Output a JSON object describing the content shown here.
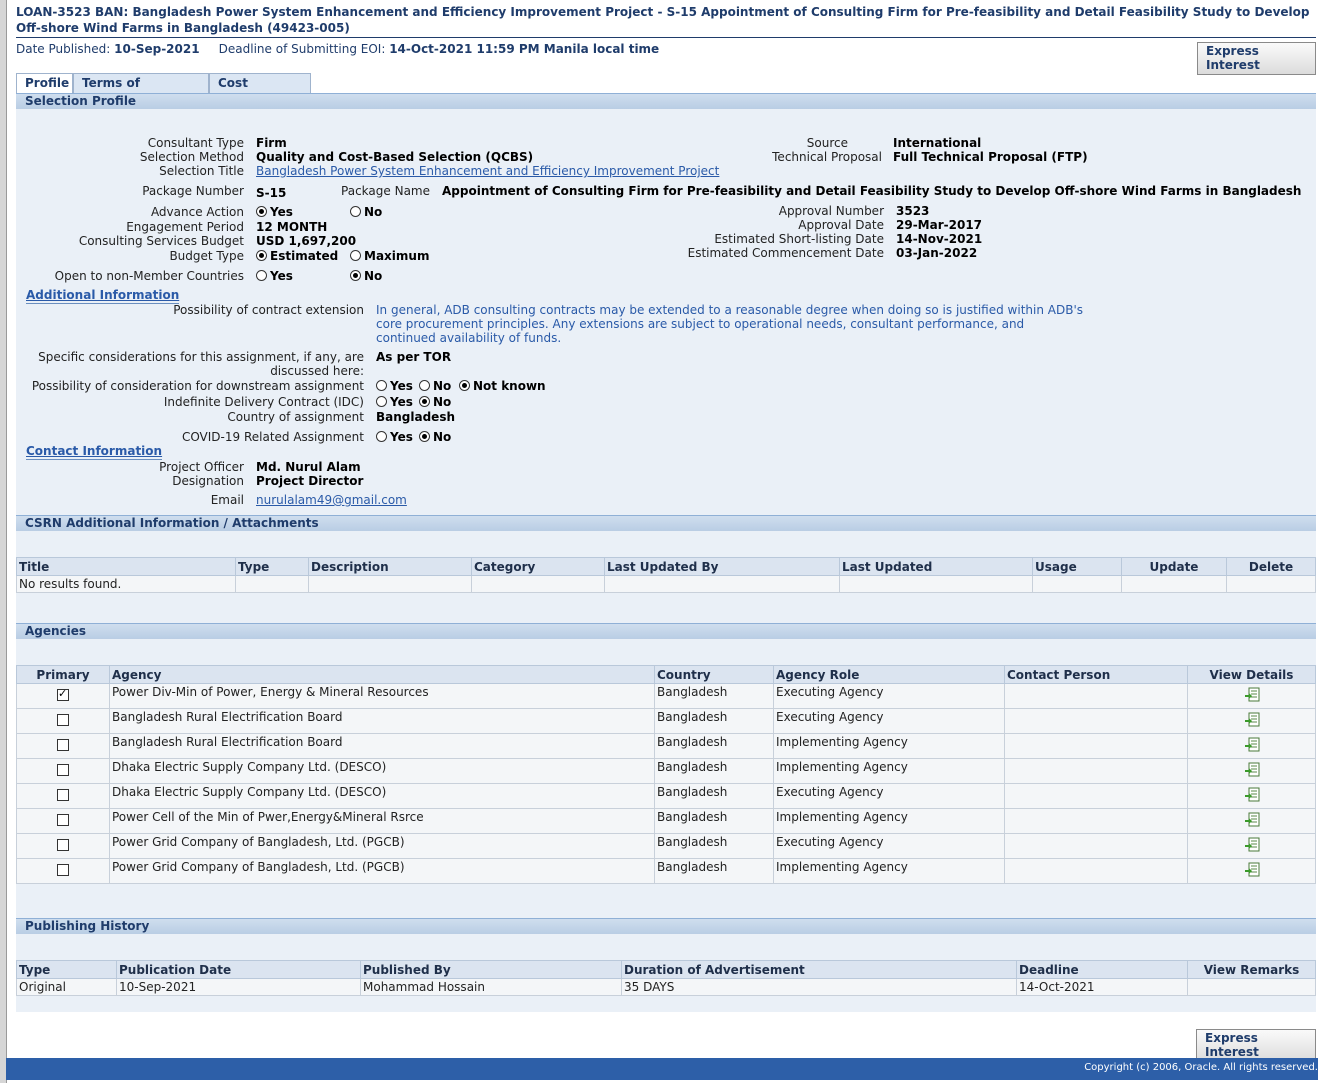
{
  "page": {
    "title": "LOAN-3523 BAN: Bangladesh Power System Enhancement and Efficiency Improvement Project - S-15 Appointment of Consulting Firm for Pre-feasibility and Detail Feasibility Study to Develop Off-shore Wind Farms in Bangladesh (49423-005)",
    "date_published_label": "Date Published:",
    "date_published": "10-Sep-2021",
    "deadline_label": "Deadline of Submitting EOI:",
    "deadline": "14-Oct-2021 11:59 PM Manila local time",
    "express_interest": "Express Interest"
  },
  "tabs": [
    "Profile",
    "Terms of Reference",
    "Cost Estimate"
  ],
  "selection_profile": {
    "header": "Selection Profile",
    "consultant_type_label": "Consultant Type",
    "consultant_type": "Firm",
    "selection_method_label": "Selection Method",
    "selection_method": "Quality and Cost-Based Selection (QCBS)",
    "selection_title_label": "Selection Title",
    "selection_title": "Bangladesh Power System Enhancement and Efficiency Improvement Project",
    "source_label": "Source",
    "source": "International",
    "technical_proposal_label": "Technical Proposal",
    "technical_proposal": "Full Technical Proposal (FTP)",
    "package_number_label": "Package Number",
    "package_number": "S-15",
    "package_name_label": "Package Name",
    "package_name": "Appointment of Consulting Firm for Pre-feasibility and Detail Feasibility Study to Develop Off-shore Wind Farms in Bangladesh",
    "advance_action_label": "Advance Action",
    "yes": "Yes",
    "no": "No",
    "engagement_period_label": "Engagement Period",
    "engagement_period": "12 MONTH",
    "budget_label": "Consulting Services Budget",
    "budget": "USD 1,697,200",
    "budget_type_label": "Budget Type",
    "estimated": "Estimated",
    "maximum": "Maximum",
    "open_label": "Open to non-Member Countries",
    "approval_number_label": "Approval Number",
    "approval_number": "3523",
    "approval_date_label": "Approval Date",
    "approval_date": "29-Mar-2017",
    "shortlisting_label": "Estimated Short-listing Date",
    "shortlisting": "14-Nov-2021",
    "commencement_label": "Estimated Commencement Date",
    "commencement": "03-Jan-2022"
  },
  "additional": {
    "header": "Additional Information",
    "extension_label": "Possibility of contract extension",
    "extension_text": "In general, ADB consulting contracts may be extended to a reasonable degree when doing so is justified within ADB's core procurement principles. Any extensions are subject to operational needs, consultant performance, and continued availability of funds.",
    "specific_label_1": "Specific considerations for this assignment, if any, are",
    "specific_label_2": "discussed here:",
    "specific_value": "As per TOR",
    "downstream_label": "Possibility of consideration for downstream assignment",
    "not_known": "Not known",
    "idc_label": "Indefinite Delivery Contract (IDC)",
    "country_label": "Country of assignment",
    "country": "Bangladesh",
    "covid_label": "COVID-19 Related Assignment"
  },
  "contact": {
    "header": "Contact Information",
    "officer_label": "Project Officer",
    "officer": "Md. Nurul Alam",
    "designation_label": "Designation",
    "designation": "Project Director",
    "email_label": "Email",
    "email": "nurulalam49@gmail.com"
  },
  "csrn": {
    "header": "CSRN Additional Information / Attachments",
    "columns": [
      "Title",
      "Type",
      "Description",
      "Category",
      "Last Updated By",
      "Last Updated",
      "Usage",
      "Update",
      "Delete"
    ],
    "empty": "No results found."
  },
  "agencies": {
    "header": "Agencies",
    "columns": [
      "Primary",
      "Agency",
      "Country",
      "Agency Role",
      "Contact Person",
      "View Details"
    ],
    "rows": [
      {
        "agency": "Power Div-Min of Power, Energy & Mineral Resources",
        "country": "Bangladesh",
        "role": "Executing Agency"
      },
      {
        "agency": "Bangladesh Rural Electrification Board",
        "country": "Bangladesh",
        "role": "Executing Agency"
      },
      {
        "agency": "Bangladesh Rural Electrification Board",
        "country": "Bangladesh",
        "role": "Implementing Agency"
      },
      {
        "agency": "Dhaka Electric Supply Company Ltd. (DESCO)",
        "country": "Bangladesh",
        "role": "Implementing Agency"
      },
      {
        "agency": "Dhaka Electric Supply Company Ltd. (DESCO)",
        "country": "Bangladesh",
        "role": "Executing Agency"
      },
      {
        "agency": "Power Cell of the Min of Pwer,Energy&Mineral Rsrce",
        "country": "Bangladesh",
        "role": "Implementing Agency"
      },
      {
        "agency": "Power Grid Company of Bangladesh, Ltd. (PGCB)",
        "country": "Bangladesh",
        "role": "Executing Agency"
      },
      {
        "agency": "Power Grid Company of Bangladesh, Ltd. (PGCB)",
        "country": "Bangladesh",
        "role": "Implementing Agency"
      }
    ]
  },
  "history": {
    "header": "Publishing History",
    "columns": [
      "Type",
      "Publication Date",
      "Published By",
      "Duration of Advertisement",
      "Deadline",
      "View Remarks"
    ],
    "rows": [
      {
        "type": "Original",
        "date": "10-Sep-2021",
        "by": "Mohammad Hossain",
        "duration": "35 DAYS",
        "deadline": "14-Oct-2021"
      }
    ]
  },
  "footer": {
    "copyright": "Copyright (c) 2006, Oracle. All rights reserved."
  }
}
